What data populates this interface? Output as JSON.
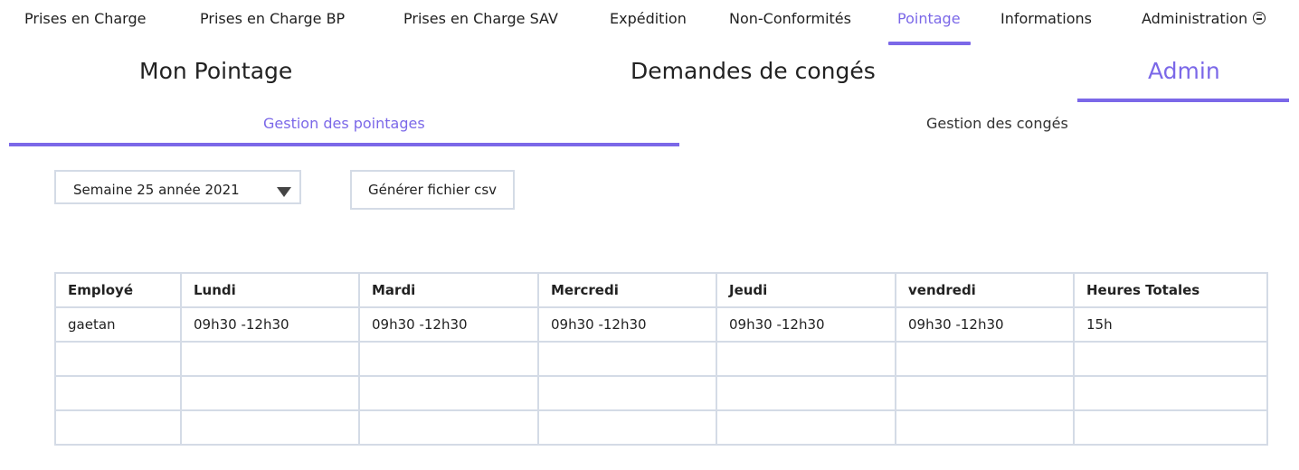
{
  "nav": {
    "items": [
      {
        "label": "Prises en Charge",
        "active": false
      },
      {
        "label": "Prises en Charge BP",
        "active": false
      },
      {
        "label": "Prises en Charge SAV",
        "active": false
      },
      {
        "label": "Expédition",
        "active": false
      },
      {
        "label": "Non-Conformités",
        "active": false
      },
      {
        "label": "Pointage",
        "active": true
      },
      {
        "label": "Informations",
        "active": false
      },
      {
        "label": "Administration",
        "active": false,
        "icon": "user-circle-icon"
      }
    ]
  },
  "sections": [
    {
      "label": "Mon Pointage",
      "active": false
    },
    {
      "label": "Demandes de congés",
      "active": false
    },
    {
      "label": "Admin",
      "active": true
    }
  ],
  "subtabs": [
    {
      "label": "Gestion des pointages",
      "active": true
    },
    {
      "label": "Gestion des congés",
      "active": false
    }
  ],
  "controls": {
    "week_select": "Semaine 25 année 2021",
    "csv_button": "Générer fichier csv"
  },
  "table": {
    "headers": [
      "Employé",
      "Lundi",
      "Mardi",
      "Mercredi",
      "Jeudi",
      "vendredi",
      "Heures Totales"
    ],
    "rows": [
      [
        "gaetan",
        "09h30 -12h30",
        "09h30 -12h30",
        "09h30 -12h30",
        "09h30 -12h30",
        "09h30 -12h30",
        "15h"
      ],
      [
        "",
        "",
        "",
        "",
        "",
        "",
        ""
      ],
      [
        "",
        "",
        "",
        "",
        "",
        "",
        ""
      ],
      [
        "",
        "",
        "",
        "",
        "",
        "",
        ""
      ]
    ]
  },
  "colors": {
    "accent": "#7b68e8",
    "border": "#d4dbe6"
  }
}
